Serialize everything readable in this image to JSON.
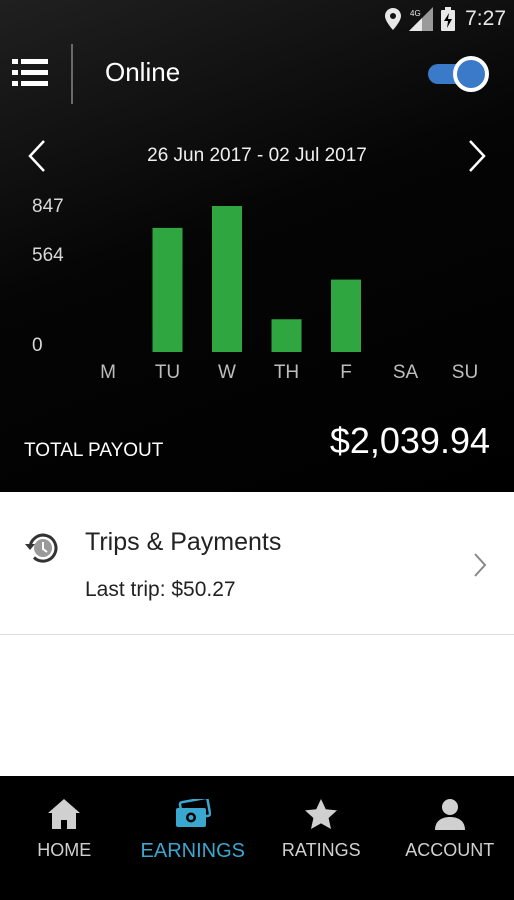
{
  "status_bar": {
    "time": "7:27",
    "network": "4G"
  },
  "header": {
    "status_label": "Online",
    "online_toggle": true
  },
  "date_nav": {
    "range": "26 Jun 2017 - 02 Jul 2017"
  },
  "chart_data": {
    "type": "bar",
    "categories": [
      "M",
      "TU",
      "W",
      "TH",
      "F",
      "SA",
      "SU"
    ],
    "values": [
      0,
      720,
      847,
      190,
      420,
      0,
      0
    ],
    "y_ticks": [
      "847",
      "564",
      "0"
    ],
    "ylim": [
      0,
      847
    ],
    "bar_color": "#2fa640"
  },
  "payout": {
    "label": "TOTAL PAYOUT",
    "value": "$2,039.94"
  },
  "trips": {
    "title": "Trips & Payments",
    "subtitle": "Last trip: $50.27"
  },
  "nav": {
    "home": "HOME",
    "earnings": "EARNINGS",
    "ratings": "RATINGS",
    "account": "ACCOUNT",
    "active": "earnings",
    "active_color": "#39a7cf"
  }
}
